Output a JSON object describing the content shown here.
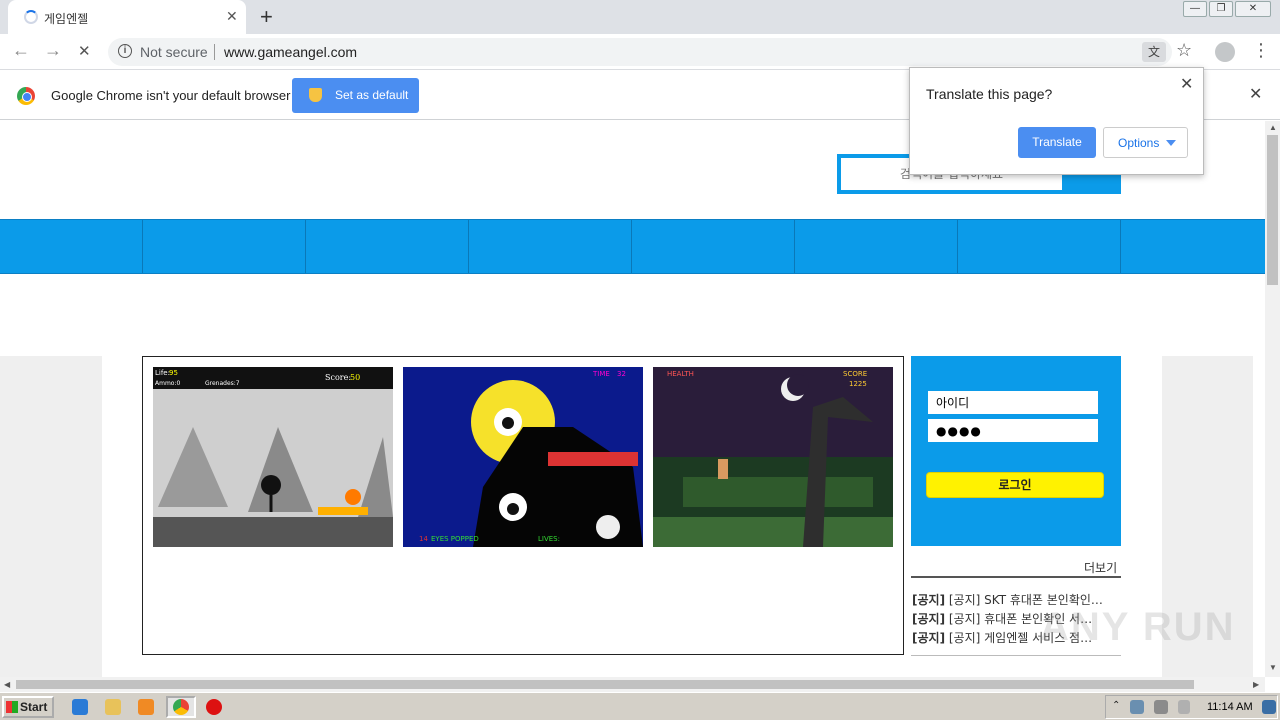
{
  "tab": {
    "title": "게임엔젤",
    "close": "✕",
    "new_tab": "+"
  },
  "window": {
    "minimize": "—",
    "restore": "❐",
    "close": "✕"
  },
  "toolbar": {
    "back": "←",
    "forward": "→",
    "reload": "✕",
    "security": "Not secure",
    "url": "www.gameangel.com",
    "star": "☆",
    "menu": "⋮",
    "translate_icon": "文"
  },
  "infobar": {
    "message": "Google Chrome isn't your default browser",
    "button": "Set as default",
    "close": "✕"
  },
  "translate_bubble": {
    "question": "Translate this page?",
    "translate": "Translate",
    "options": "Options",
    "close": "✕"
  },
  "page": {
    "search_placeholder": "검색어를 입력하세요",
    "login": {
      "id_value": "아이디",
      "pw_value": "●●●●",
      "button": "로그인"
    },
    "more": "더보기",
    "notices": [
      {
        "tag": "[공지]",
        "text": " [공지] SKT 휴대폰 본인확인…"
      },
      {
        "tag": "[공지]",
        "text": " [공지] 휴대폰 본인확인 서…"
      },
      {
        "tag": "[공지]",
        "text": " [공지] 게임엔젤 서비스 점…"
      }
    ],
    "games": [
      {
        "hud": [
          "Life:",
          "95",
          "Ammo:0",
          "Grenades:7",
          "Score:",
          "50"
        ]
      },
      {
        "hud": [
          "TIME",
          "32",
          "14",
          "EYES POPPED",
          "LIVES:"
        ]
      },
      {
        "hud": [
          "HEALTH",
          "SCORE",
          "1225"
        ]
      }
    ]
  },
  "taskbar": {
    "start": "Start",
    "clock": "11:14 AM"
  },
  "watermark": "ANY RUN",
  "colors": {
    "site_blue": "#0b9be9",
    "login_yellow": "#fff200",
    "chrome_blue": "#4b8ef1"
  }
}
